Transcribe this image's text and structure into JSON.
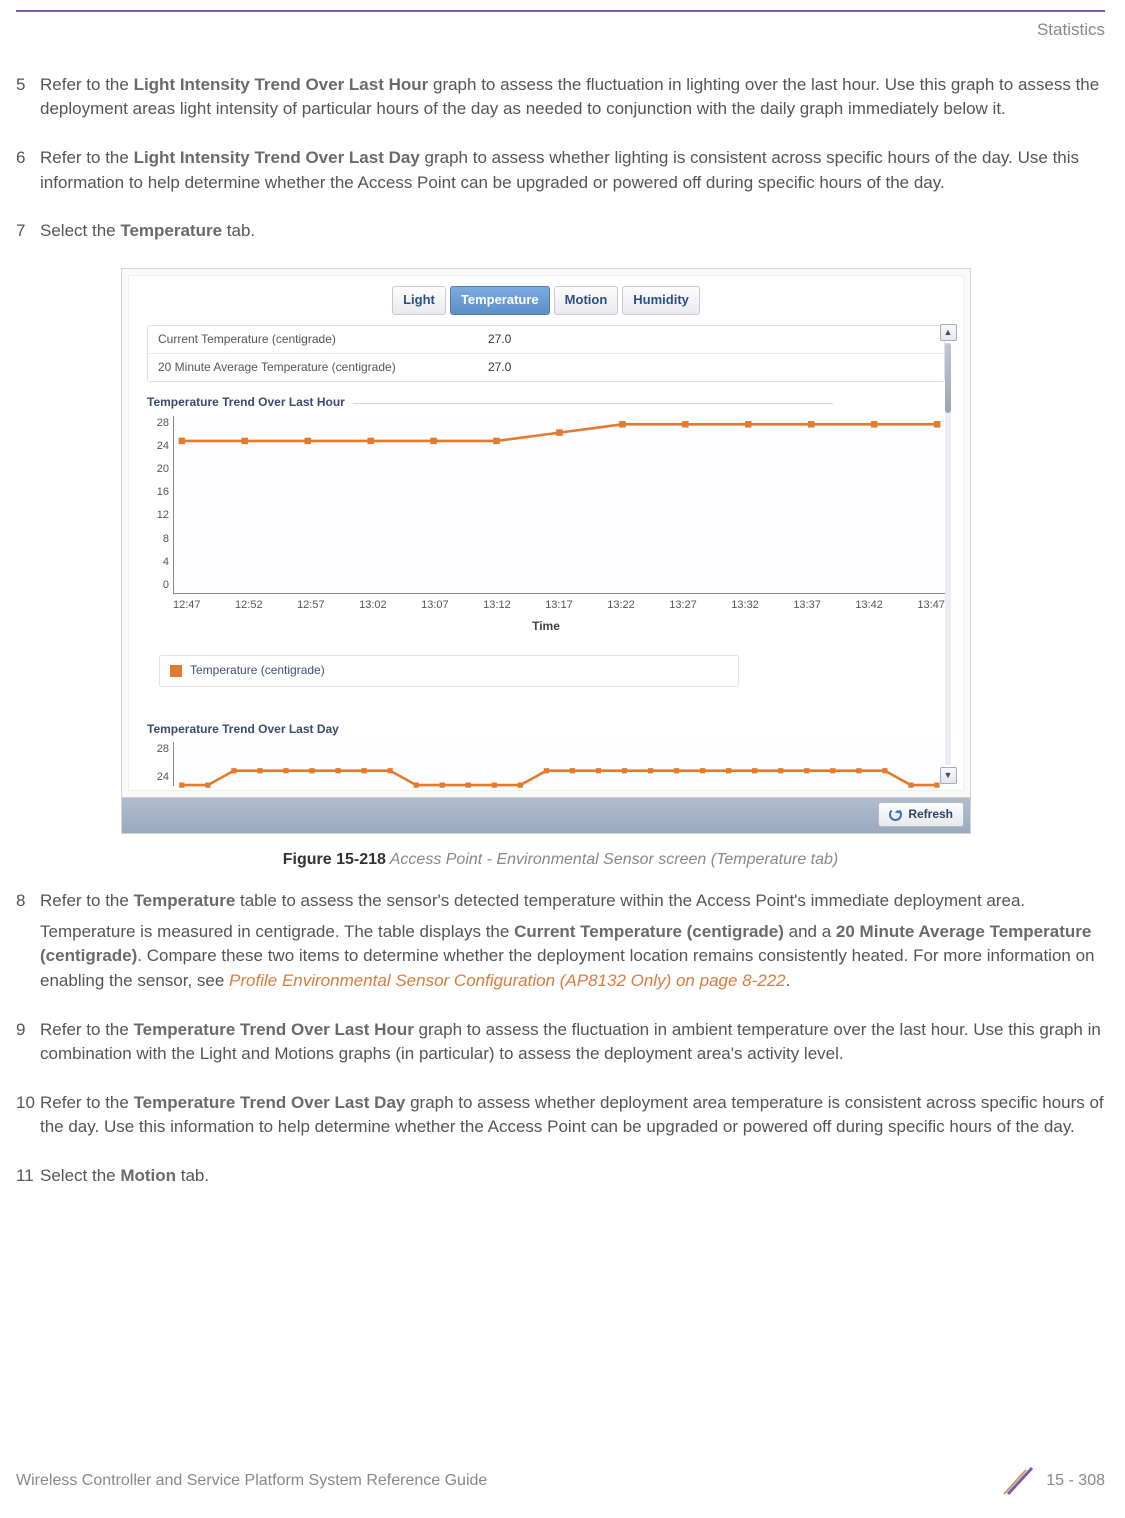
{
  "header": {
    "section": "Statistics"
  },
  "steps": {
    "s5": {
      "num": "5",
      "prefix": "Refer to the ",
      "term": "Light Intensity Trend Over Last Hour",
      "rest": " graph to assess the fluctuation in lighting over the last hour. Use this graph to assess the deployment areas light intensity of particular hours of the day as needed to conjunction with the daily graph immediately below it."
    },
    "s6": {
      "num": "6",
      "prefix": "Refer to the ",
      "term": "Light Intensity Trend Over Last Day",
      "rest": " graph to assess whether lighting is consistent across specific hours of the day. Use this information to help determine whether the Access Point can be upgraded or powered off during specific hours of the day."
    },
    "s7": {
      "num": "7",
      "prefix": " Select the ",
      "term": "Temperature",
      "rest": " tab."
    },
    "s8": {
      "num": "8",
      "p1_prefix": "Refer to the ",
      "p1_term": "Temperature",
      "p1_rest": " table to assess the sensor's detected temperature within the Access Point's immediate deployment area.",
      "p2_a": "Temperature is measured in centigrade. The table displays the ",
      "p2_term1": "Current Temperature (centigrade)",
      "p2_mid": " and a ",
      "p2_term2": "20 Minute Average Temperature (centigrade)",
      "p2_b": ". Compare these two items to determine whether the deployment location remains consistently heated. For more information on enabling the sensor, see ",
      "p2_link": "Profile Environmental Sensor Configuration (AP8132 Only) on page 8-222",
      "p2_end": "."
    },
    "s9": {
      "num": "9",
      "prefix": "Refer to the ",
      "term": "Temperature Trend Over Last Hour",
      "rest": " graph to assess the fluctuation in ambient temperature over the last hour. Use this graph in combination with the Light and Motions graphs (in particular) to assess the deployment area's activity level."
    },
    "s10": {
      "num": "10",
      "prefix": "Refer to the ",
      "term": "Temperature Trend Over Last Day",
      "rest": " graph to assess whether deployment area temperature is consistent across specific hours of the day. Use this information to help determine whether the Access Point can be upgraded or powered off during specific hours of the day."
    },
    "s11": {
      "num": "11",
      "prefix": " Select the ",
      "term": "Motion",
      "rest": " tab."
    }
  },
  "screen": {
    "tabs": {
      "light": "Light",
      "temperature": "Temperature",
      "motion": "Motion",
      "humidity": "Humidity"
    },
    "table": {
      "row1_label": "Current Temperature (centigrade)",
      "row1_value": "27.0",
      "row2_label": "20 Minute Average Temperature (centigrade)",
      "row2_value": "27.0"
    },
    "chart1": {
      "title": "Temperature Trend Over Last Hour",
      "xaxis_label": "Time",
      "legend": "Temperature (centigrade)"
    },
    "chart2": {
      "title": "Temperature Trend Over Last Day"
    },
    "refresh": "Refresh"
  },
  "figure": {
    "label": "Figure 15-218",
    "caption": "  Access Point - Environmental Sensor screen (Temperature tab)"
  },
  "footer": {
    "guide": "Wireless Controller and Service Platform System Reference Guide",
    "page": "15 - 308"
  },
  "chart_data": [
    {
      "type": "line",
      "title": "Temperature Trend Over Last Hour",
      "xlabel": "Time",
      "ylabel": "",
      "ylim": [
        0,
        28
      ],
      "yticks": [
        28,
        24,
        20,
        16,
        12,
        8,
        4,
        0
      ],
      "categories": [
        "12:47",
        "12:52",
        "12:57",
        "13:02",
        "13:07",
        "13:12",
        "13:17",
        "13:22",
        "13:27",
        "13:32",
        "13:37",
        "13:42",
        "13:47"
      ],
      "series": [
        {
          "name": "Temperature (centigrade)",
          "values": [
            25,
            25,
            25,
            25,
            25,
            25,
            26,
            27,
            27,
            27,
            27,
            27,
            27
          ]
        }
      ],
      "legend_position": "bottom"
    },
    {
      "type": "line",
      "title": "Temperature Trend Over Last Day",
      "ylim": [
        24,
        28
      ],
      "yticks": [
        28,
        24
      ],
      "series": [
        {
          "name": "Temperature (centigrade)",
          "values": [
            25,
            25,
            26,
            26,
            26,
            26,
            26,
            26,
            26,
            25,
            25,
            25,
            25,
            25,
            26,
            26,
            26,
            26,
            26,
            26,
            26,
            26,
            26,
            26,
            26,
            26,
            26,
            26,
            25,
            25
          ]
        }
      ]
    }
  ]
}
